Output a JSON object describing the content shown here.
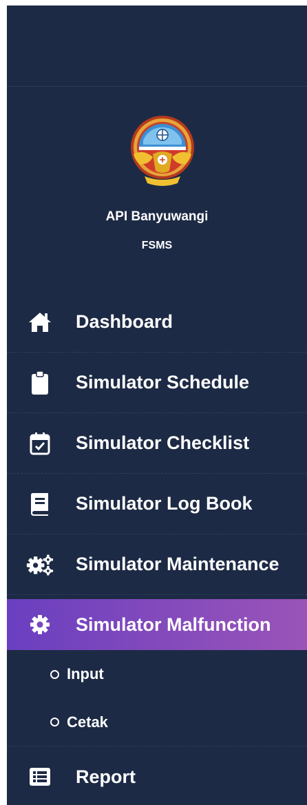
{
  "brand": {
    "name": "API Banyuwangi",
    "sub": "FSMS"
  },
  "nav": {
    "items": [
      {
        "label": "Dashboard",
        "icon": "home-icon"
      },
      {
        "label": "Simulator Schedule",
        "icon": "clipboard-icon"
      },
      {
        "label": "Simulator Checklist",
        "icon": "calendar-check-icon"
      },
      {
        "label": "Simulator Log Book",
        "icon": "book-icon"
      },
      {
        "label": "Simulator Maintenance",
        "icon": "cogs-icon"
      },
      {
        "label": "Simulator Malfunction",
        "icon": "cog-icon",
        "active": true
      },
      {
        "label": "Report",
        "icon": "list-alt-icon"
      }
    ],
    "sub_items": [
      {
        "label": "Input"
      },
      {
        "label": "Cetak"
      }
    ]
  },
  "colors": {
    "sidebar_bg": "#1d2a45",
    "active_start": "#6a3fc0",
    "active_end": "#9a54b8",
    "text": "#ffffff"
  }
}
